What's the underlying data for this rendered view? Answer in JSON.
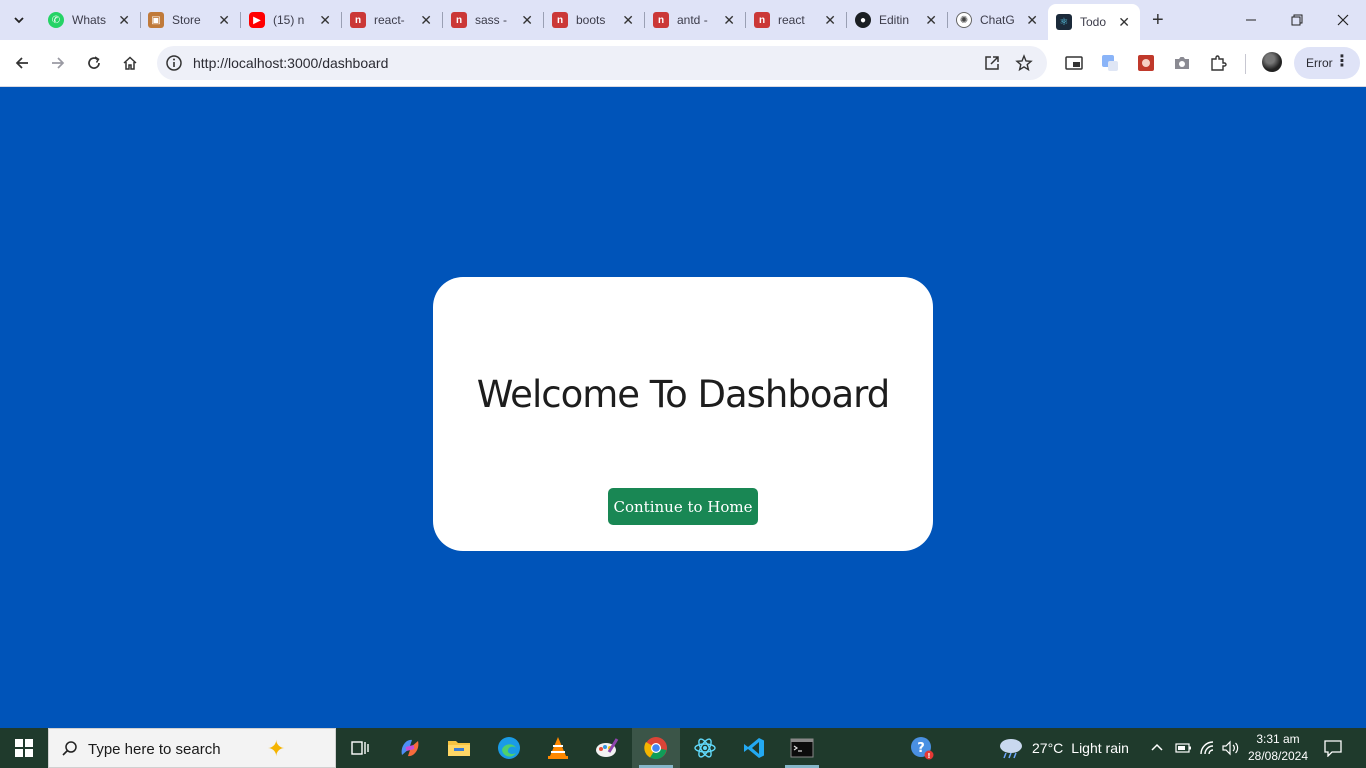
{
  "browser": {
    "tabs": [
      {
        "title": "WhatsApp",
        "favicon": "whatsapp-icon",
        "color": "#25d366"
      },
      {
        "title": "Store",
        "favicon": "store-icon",
        "color": "#c07a3a"
      },
      {
        "title": "(15) n",
        "favicon": "youtube-icon",
        "color": "#ff0000"
      },
      {
        "title": "react-",
        "favicon": "npm-icon",
        "color": "#cb3837"
      },
      {
        "title": "sass -",
        "favicon": "npm-icon",
        "color": "#cb3837"
      },
      {
        "title": "boots",
        "favicon": "npm-icon",
        "color": "#cb3837"
      },
      {
        "title": "antd -",
        "favicon": "npm-icon",
        "color": "#cb3837"
      },
      {
        "title": "react",
        "favicon": "npm-icon",
        "color": "#cb3837"
      },
      {
        "title": "Editin",
        "favicon": "github-icon",
        "color": "#1b1f23"
      },
      {
        "title": "ChatG",
        "favicon": "chatgpt-icon",
        "color": "#555555"
      },
      {
        "title": "Todo",
        "favicon": "react-icon",
        "color": "#1b2a3a",
        "active": true
      }
    ],
    "url": "http://localhost:3000/dashboard",
    "error_label": "Error"
  },
  "page": {
    "heading": "Welcome To Dashboard",
    "button_label": "Continue to Home",
    "background_color": "#0054b9",
    "button_color": "#198754"
  },
  "taskbar": {
    "search_placeholder": "Type here to search",
    "weather_temp": "27°C",
    "weather_text": "Light rain",
    "time": "3:31 am",
    "date": "28/08/2024"
  }
}
